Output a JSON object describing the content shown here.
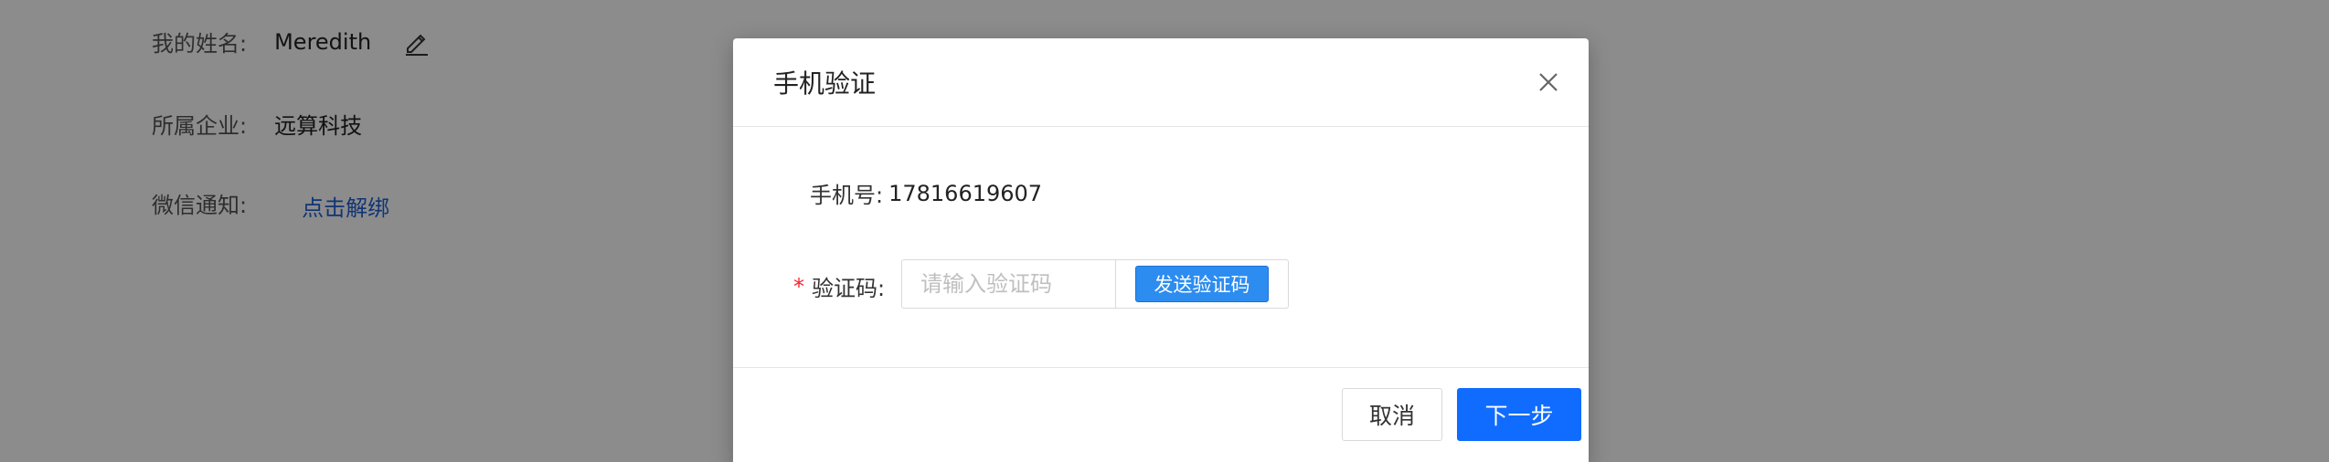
{
  "profile": {
    "name_label": "我的姓名:",
    "name_value": "Meredith",
    "company_label": "所属企业:",
    "company_value": "远算科技",
    "wechat_label": "微信通知:",
    "wechat_action": "点击解绑",
    "edit_icon": "edit-pencil-icon"
  },
  "modal": {
    "title": "手机验证",
    "close_icon": "close-icon",
    "phone_label": "手机号:",
    "phone_value": "17816619607",
    "code_required_mark": "*",
    "code_label": "验证码:",
    "code_placeholder": "请输入验证码",
    "code_value": "",
    "send_code_label": "发送验证码",
    "cancel_label": "取消",
    "next_label": "下一步"
  },
  "colors": {
    "primary": "#0f6cff",
    "send_button": "#2d8cf0",
    "link": "#1f5fd6",
    "required": "#f5222d",
    "overlay": "rgba(0,0,0,0.45)"
  }
}
